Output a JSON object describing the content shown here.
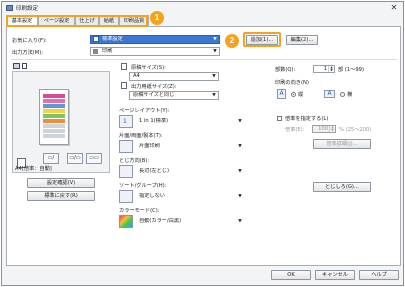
{
  "window": {
    "title": "印刷設定",
    "close_glyph": "✕"
  },
  "tabs": [
    "基本設定",
    "ページ設定",
    "仕上げ",
    "給紙",
    "印刷品質"
  ],
  "badges": {
    "one": "1",
    "two": "2"
  },
  "favorite": {
    "label": "お気に入り(F):",
    "value": "標準設定",
    "add_button": "追加(1)...",
    "edit_button": "編集(2)..."
  },
  "output_method": {
    "label": "出力方法(M):",
    "value": "印刷"
  },
  "preview": {
    "caption": "A4[倍率：自動]",
    "settings_button": "設定確認(V)",
    "restore_button": "標準に戻す(R)"
  },
  "original_size": {
    "label": "原稿サイズ(S):",
    "value": "A4"
  },
  "output_paper": {
    "label": "出力用紙サイズ(Z):",
    "value": "原稿サイズと同じ"
  },
  "page_layout": {
    "label": "ページレイアウト(Y):",
    "value": "1 in 1(標準)"
  },
  "duplex": {
    "label": "片面/両面/製本(T):",
    "value": "片面印刷"
  },
  "binding": {
    "label": "とじ方向(B):",
    "value": "長辺(左とじ)"
  },
  "sort": {
    "label": "ソート/グループ(H):",
    "value": "指定しない"
  },
  "color_mode": {
    "label": "カラーモード(C):",
    "value": "自動(カラー/白黒)"
  },
  "copies": {
    "label": "部数(Q):",
    "value": "1",
    "unit": "部 (1〜99)"
  },
  "orientation": {
    "label": "印刷の向き(N)",
    "portrait": "縦",
    "landscape": "横",
    "icon_letter": "A"
  },
  "scaling": {
    "checkbox_label": "倍率を指定する(L)",
    "sub_label": "倍率(E):",
    "value": "100",
    "unit": "% (25〜200)",
    "detail_button": "倍率詳細(J)..."
  },
  "binding_button": "とじしろ(G)...",
  "footer": {
    "ok": "OK",
    "cancel": "キャンセル",
    "help": "ヘルプ"
  },
  "colors": {
    "accent": "#f6a21a",
    "selection": "#3a78d4"
  }
}
